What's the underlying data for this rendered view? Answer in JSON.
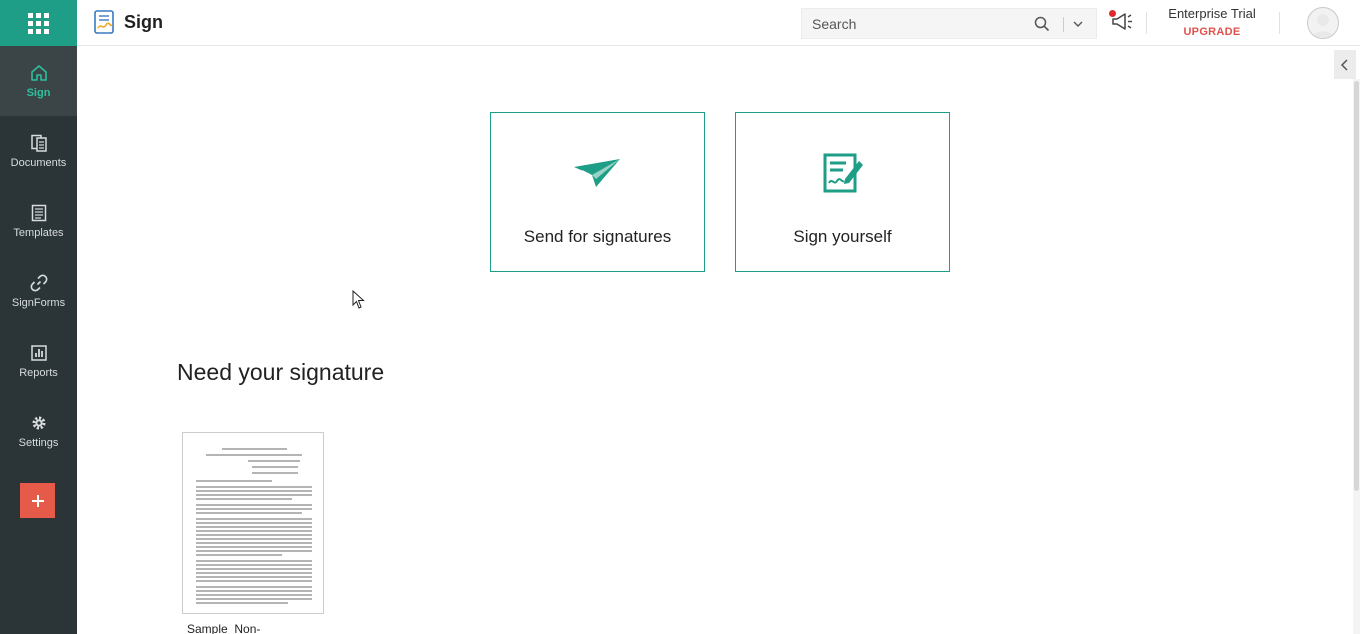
{
  "app": {
    "title": "Sign"
  },
  "search": {
    "placeholder": "Search"
  },
  "plan": {
    "name": "Enterprise Trial",
    "upgrade_label": "UPGRADE"
  },
  "sidebar": {
    "items": [
      {
        "label": "Sign",
        "icon": "home-icon",
        "active": true
      },
      {
        "label": "Documents",
        "icon": "documents-icon",
        "active": false
      },
      {
        "label": "Templates",
        "icon": "templates-icon",
        "active": false
      },
      {
        "label": "SignForms",
        "icon": "link-icon",
        "active": false
      },
      {
        "label": "Reports",
        "icon": "reports-icon",
        "active": false
      },
      {
        "label": "Settings",
        "icon": "gear-icon",
        "active": false
      }
    ],
    "add_button_label": "+"
  },
  "actions": [
    {
      "label": "Send for signatures",
      "icon": "paper-plane-icon"
    },
    {
      "label": "Sign yourself",
      "icon": "sign-document-icon"
    }
  ],
  "section": {
    "title": "Need your signature"
  },
  "documents": [
    {
      "name": "Sample_Non-"
    }
  ],
  "colors": {
    "accent": "#1e9e86",
    "sidebar_bg": "#2b3538",
    "add_button": "#e55a49",
    "upgrade": "#e0524e"
  }
}
